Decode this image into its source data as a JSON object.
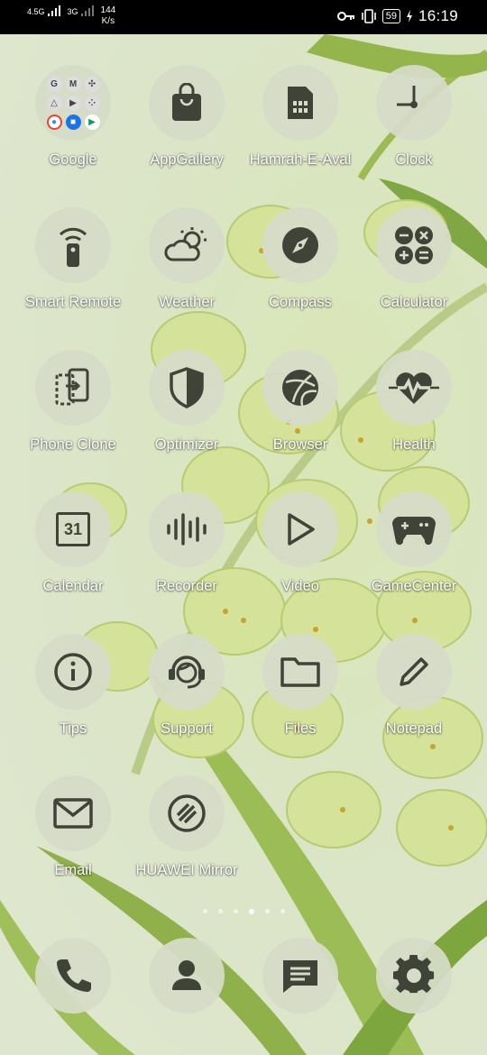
{
  "status_bar": {
    "network_1": "4.5G",
    "network_2": "3G",
    "speed_value": "144",
    "speed_unit": "K/s",
    "battery": "59",
    "time": "16:19"
  },
  "apps": {
    "row1": [
      "Google",
      "AppGallery",
      "Hamrah-E-Aval",
      "Clock"
    ],
    "row2": [
      "Smart Remote",
      "Weather",
      "Compass",
      "Calculator"
    ],
    "row3": [
      "Phone Clone",
      "Optimizer",
      "Browser",
      "Health"
    ],
    "row4": [
      "Calendar",
      "Recorder",
      "Video",
      "GameCenter"
    ],
    "row5": [
      "Tips",
      "Support",
      "Files",
      "Notepad"
    ],
    "row6": [
      "Email",
      "HUAWEI Mirror"
    ]
  },
  "calendar_day": "31",
  "page_indicator": {
    "count": 6,
    "active_index": 3
  },
  "icon_color": "#3f4338"
}
